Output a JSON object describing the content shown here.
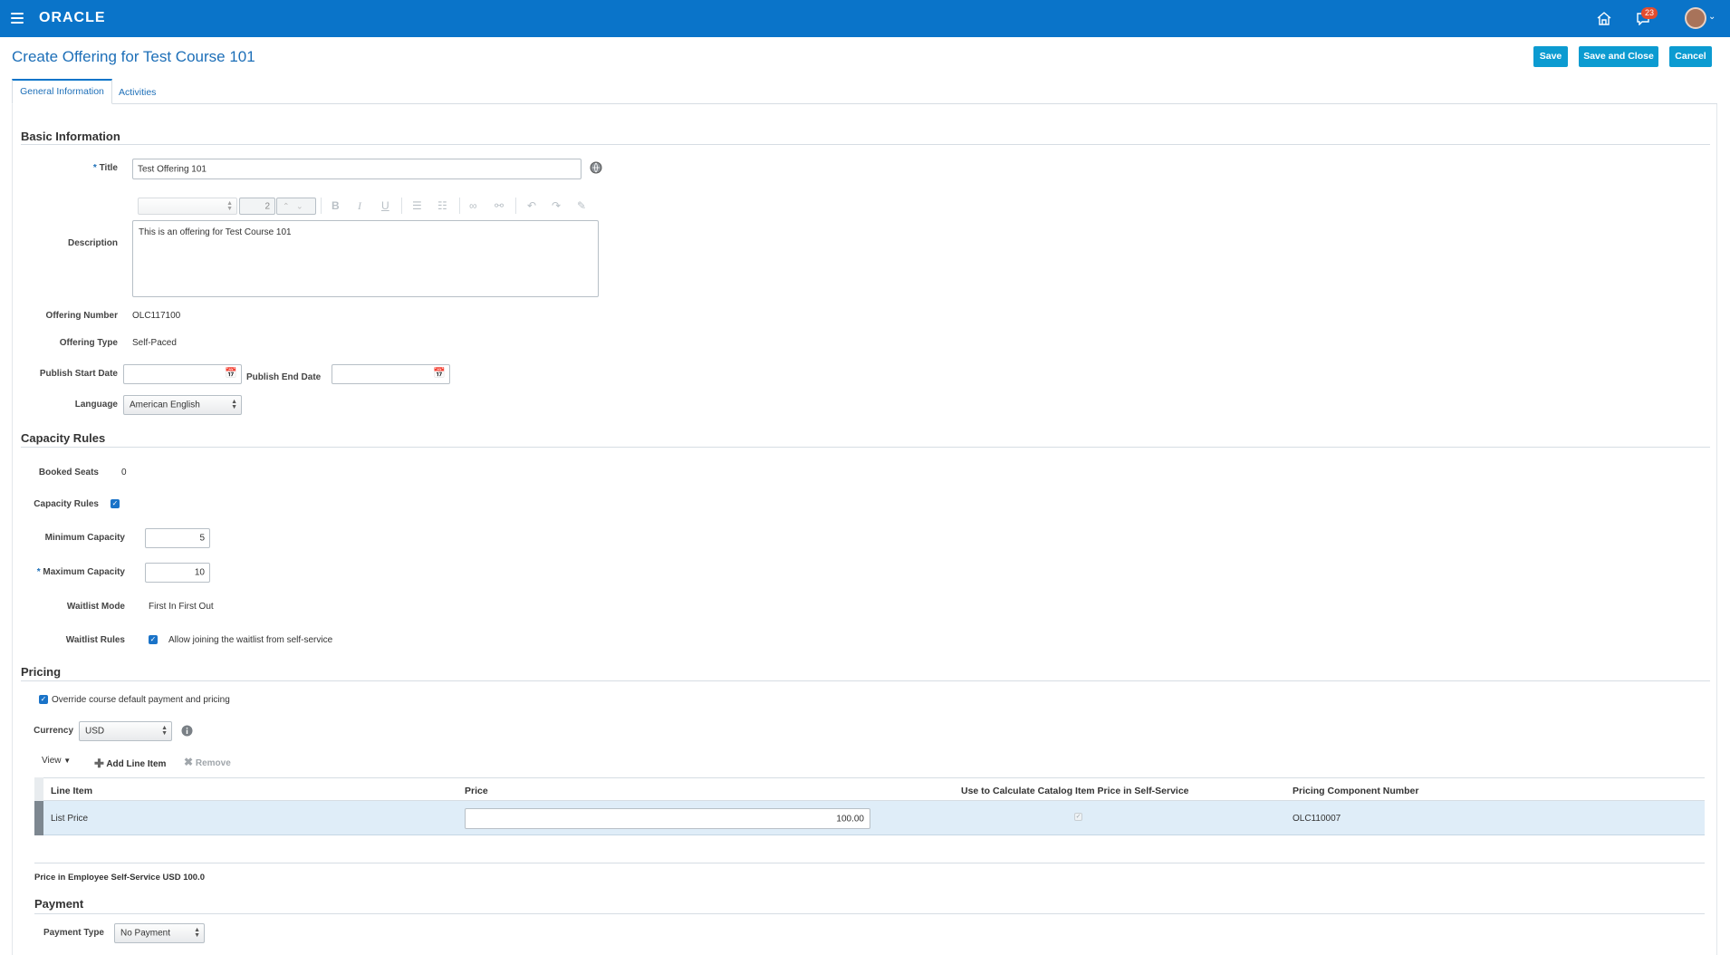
{
  "header": {
    "logo": "ORACLE",
    "notification_count": "23"
  },
  "page": {
    "title": "Create Offering for Test Course 101",
    "buttons": {
      "save": "Save",
      "save_close": "Save and Close",
      "cancel": "Cancel"
    },
    "tabs": [
      {
        "label": "General Information"
      },
      {
        "label": "Activities"
      }
    ]
  },
  "basic": {
    "section_title": "Basic Information",
    "title_label": "Title",
    "title_value": "Test Offering 101",
    "toolbar": {
      "font_size": "2"
    },
    "description_label": "Description",
    "description_value": "This is an offering for Test Course 101",
    "offering_number_label": "Offering Number",
    "offering_number_value": "OLC117100",
    "offering_type_label": "Offering Type",
    "offering_type_value": "Self-Paced",
    "publish_start_label": "Publish Start Date",
    "publish_end_label": "Publish End Date",
    "language_label": "Language",
    "language_value": "American English"
  },
  "capacity": {
    "section_title": "Capacity Rules",
    "booked_seats_label": "Booked Seats",
    "booked_seats_value": "0",
    "capacity_rules_label": "Capacity Rules",
    "min_label": "Minimum Capacity",
    "min_value": "5",
    "max_label": "Maximum Capacity",
    "max_value": "10",
    "waitlist_mode_label": "Waitlist Mode",
    "waitlist_mode_value": "First In First Out",
    "waitlist_rules_label": "Waitlist Rules",
    "waitlist_rules_value": "Allow joining the waitlist from self-service"
  },
  "pricing": {
    "section_title": "Pricing",
    "override_label": "Override course default payment and pricing",
    "currency_label": "Currency",
    "currency_value": "USD",
    "view_label": "View",
    "add_line_item": "Add Line Item",
    "remove": "Remove",
    "columns": [
      "Line Item",
      "Price",
      "Use to Calculate Catalog Item Price in Self-Service",
      "Pricing Component Number"
    ],
    "rows": [
      {
        "line_item": "List Price",
        "price": "100.00",
        "component_number": "OLC110007"
      }
    ],
    "summary": "Price in Employee Self-Service USD 100.0"
  },
  "payment": {
    "section_title": "Payment",
    "payment_type_label": "Payment Type",
    "payment_type_value": "No Payment"
  },
  "colors": {
    "brand_bar": "#0a74c9",
    "button": "#0c9bd1",
    "badge": "#e44c2e",
    "selected_row": "#dfedf8"
  }
}
